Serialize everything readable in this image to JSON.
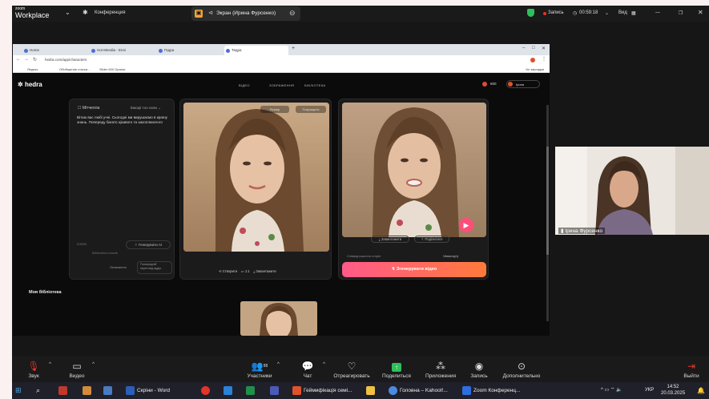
{
  "zoom": {
    "logo_small": "zoom",
    "logo_big": "Workplace",
    "meeting_label": "Конференция",
    "share_status": "Экран (Ирина Фурсенко)",
    "recording_label": "Запись",
    "timer": "00:59:18",
    "view_label": "Вид",
    "toolbar": {
      "audio": "Звук",
      "video": "Видео",
      "participants": "Участники",
      "participants_count": "88",
      "chat": "Чат",
      "reactions": "Отреагировать",
      "share": "Поделиться",
      "apps": "Приложения",
      "record": "Запись",
      "more": "Дополнительно",
      "leave": "Выйти"
    },
    "participant_name": "Ірина Фурсенко"
  },
  "browser": {
    "tabs": [
      "Home",
      "Hot Mendia - Enni",
      "Гедра",
      "Тедра"
    ],
    "url": "hedra.com/app/characters",
    "bookmarks": [
      "Яндекс",
      "Обобщение статьи...",
      "Slider 600 Оратки"
    ],
    "bookmarks_right": "Усі закладки"
  },
  "hedra": {
    "logo": "hedra",
    "nav": [
      "ВІДЕО",
      "ЗОБРАЖЕННЯ",
      "БІБЛІОТЕКА"
    ],
    "credits": "600",
    "user": "Ірина",
    "script_panel": {
      "label": "Мітчелла",
      "emotion": "Емоції тон сили",
      "text": "Вітаю вас любі учні. Сьогодні ми вирушаємо в країну знань. Попереду багато цікавого та захоплюючого",
      "char_count": "0/3000",
      "generate_ai": "Генерувати AI",
      "voice_label": "Бібліотека голосів",
      "bottom_option": "Оновлення",
      "language": "Попередній перегляд аудіо"
    },
    "image_panel": {
      "top_btn_1": "Розмір",
      "top_btn_2": "Покращити",
      "regenerate": "Створити",
      "ratio": "1:1",
      "download": "Завантажити"
    },
    "video_panel": {
      "download": "Завантажити",
      "share": "Поділитися",
      "aspect_label": "Співвідношення сторін",
      "resolution": "Чіткість(л)",
      "generate_video": "Згенерувати відео"
    },
    "library_title": "Моя бібліотека"
  },
  "taskbar": {
    "items": [
      {
        "label": "Скріни - Word",
        "color": "#2b5eb8"
      },
      {
        "label": "Геймифікація семі...",
        "color": "#e0522a"
      },
      {
        "label": "Головна – Kahoot!...",
        "color": "#4a8ae0"
      },
      {
        "label": "Zoom Конференц...",
        "color": "#2d6fe0"
      }
    ],
    "lang": "УКР",
    "time": "14:52",
    "date": "20.03.2025"
  },
  "colors": {
    "accent_gradient_start": "#ff5a8a",
    "accent_gradient_end": "#ff7a3a",
    "zoom_bar": "#1a1a1a",
    "shield_green": "#2fbf5a",
    "record_red": "#e0352b"
  }
}
